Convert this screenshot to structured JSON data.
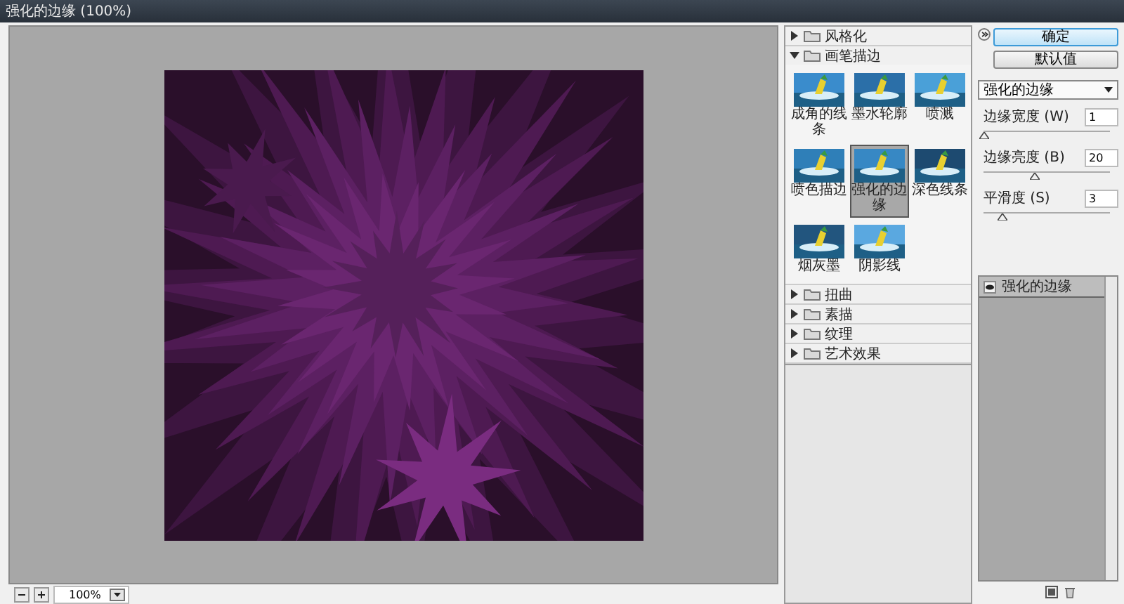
{
  "window": {
    "title": "强化的边缘 (100%)"
  },
  "preview": {
    "zoom": "100%"
  },
  "filter_categories": [
    {
      "label": "风格化",
      "expanded": false
    },
    {
      "label": "画笔描边",
      "expanded": true,
      "filters": [
        {
          "label": "成角的线条",
          "selected": false
        },
        {
          "label": "墨水轮廓",
          "selected": false
        },
        {
          "label": "喷溅",
          "selected": false
        },
        {
          "label": "喷色描边",
          "selected": false
        },
        {
          "label": "强化的边缘",
          "selected": true
        },
        {
          "label": "深色线条",
          "selected": false
        },
        {
          "label": "烟灰墨",
          "selected": false
        },
        {
          "label": "阴影线",
          "selected": false
        }
      ]
    },
    {
      "label": "扭曲",
      "expanded": false
    },
    {
      "label": "素描",
      "expanded": false
    },
    {
      "label": "纹理",
      "expanded": false
    },
    {
      "label": "艺术效果",
      "expanded": false
    }
  ],
  "buttons": [
    {
      "label": "确定",
      "kind": "primary"
    },
    {
      "label": "默认值",
      "kind": "normal"
    }
  ],
  "filter_select": {
    "value": "强化的边缘"
  },
  "parameters": [
    {
      "label": "边缘宽度 (W)",
      "value": "1",
      "level": 0
    },
    {
      "label": "边缘亮度 (B)",
      "value": "20",
      "level": 0.4
    },
    {
      "label": "平滑度 (S)",
      "value": "3",
      "level": 0.14
    }
  ],
  "effect_layers": [
    {
      "label": "强化的边缘",
      "visible": true
    }
  ]
}
